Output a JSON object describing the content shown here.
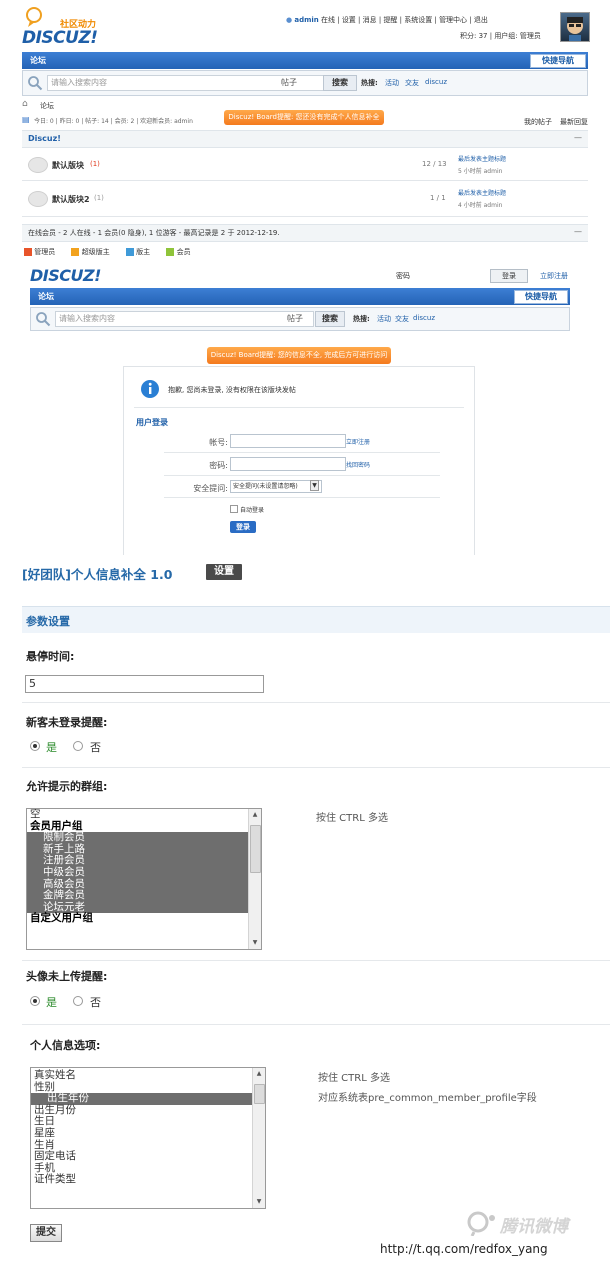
{
  "forum_page": {
    "logo_slogan": "社区动力",
    "logo_text": "DISCUZ!",
    "topbar_user": "admin",
    "topbar_links": [
      "在线",
      "设置",
      "消息",
      "提醒",
      "系统设置",
      "管理中心",
      "退出"
    ],
    "topbar_second": [
      "积分: 37",
      "用户组: 管理员"
    ],
    "nav_tab": "论坛",
    "quick_nav": "快捷导航",
    "search_placeholder": "请输入搜索内容",
    "search_scope": "帖子",
    "search_button": "搜索",
    "hot_label": "热搜:",
    "hot_terms": [
      "活动",
      "交友",
      "discuz"
    ],
    "breadcrumb": "论坛",
    "stats": "今日: 0 | 昨日: 0 | 帖子: 14 | 会员: 2 | 欢迎新会员: admin",
    "orange_notice": "Discuz! Board提醒: 您还没有完成个人信息补全",
    "right_links": [
      "我的帖子",
      "最新回复"
    ],
    "category": "Discuz!",
    "forums": [
      {
        "name": "默认版块",
        "count": "(1)",
        "stats": "12 / 13",
        "last_title": "最后发表主题标题",
        "last_time": "5 小时前 admin"
      },
      {
        "name": "默认版块2",
        "count": "(1)",
        "stats": "1 / 1",
        "last_title": "最后发表主题标题",
        "last_time": "4 小时前 admin"
      }
    ],
    "online_info": "在线会员 - 2 人在线 - 1 会员(0 隐身), 1 位游客 - 最高记录是 2 于 2012-12-19.",
    "legend": [
      "管理员",
      "超级版主",
      "版主",
      "会员"
    ]
  },
  "login_page": {
    "logo_text": "DISCUZ!",
    "top_link": "密码",
    "login_button": "登录",
    "register_link": "立即注册",
    "nav_tab": "论坛",
    "quick_nav": "快捷导航",
    "search_placeholder": "请输入搜索内容",
    "search_scope": "帖子",
    "search_button": "搜索",
    "hot_label": "热搜:",
    "hot_terms": [
      "活动",
      "交友",
      "discuz"
    ],
    "orange_notice": "Discuz! Board提醒: 您的信息不全, 完成后方可进行访问",
    "info_message": "抱歉, 您尚未登录, 没有权限在该版块发帖",
    "section_title": "用户登录",
    "username_label": "帐号:",
    "password_label": "密码:",
    "security_label": "安全提问:",
    "register_text": "立即注册",
    "forgot_text": "找回密码",
    "security_option": "安全提问(未设置请忽略)",
    "remember_label": "自动登录",
    "submit_label": "登录"
  },
  "plugin": {
    "title": "[好团队]个人信息补全 1.0",
    "settings_btn": "设置",
    "section": "参数设置",
    "q_time_label": "悬停时间:",
    "q_time_value": "5",
    "guest_label": "新客未登录提醒:",
    "yes": "是",
    "no": "否",
    "groups_label": "允许提示的群组:",
    "groups_hint": "按住 CTRL 多选",
    "groups": [
      {
        "text": "空",
        "kind": "plain"
      },
      {
        "text": "会员用户组",
        "kind": "group"
      },
      {
        "text": "限制会员",
        "kind": "sel"
      },
      {
        "text": "新手上路",
        "kind": "sel"
      },
      {
        "text": "注册会员",
        "kind": "sel"
      },
      {
        "text": "中级会员",
        "kind": "sel"
      },
      {
        "text": "高级会员",
        "kind": "sel"
      },
      {
        "text": "金牌会员",
        "kind": "sel"
      },
      {
        "text": "论坛元老",
        "kind": "sel"
      },
      {
        "text": "自定义用户组",
        "kind": "group"
      }
    ],
    "avatar_label": "头像未上传提醒:",
    "profile_label": "个人信息选项:",
    "profile_hint_1": "按住 CTRL 多选",
    "profile_hint_2": "对应系统表pre_common_member_profile字段",
    "profile_options": [
      {
        "text": "真实姓名",
        "kind": "plain"
      },
      {
        "text": "性别",
        "kind": "plain"
      },
      {
        "text": "出生年份",
        "kind": "sel"
      },
      {
        "text": "出生月份",
        "kind": "plain"
      },
      {
        "text": "生日",
        "kind": "plain"
      },
      {
        "text": "星座",
        "kind": "plain"
      },
      {
        "text": "生肖",
        "kind": "plain"
      },
      {
        "text": "固定电话",
        "kind": "plain"
      },
      {
        "text": "手机",
        "kind": "plain"
      },
      {
        "text": "证件类型",
        "kind": "plain"
      }
    ],
    "submit": "提交"
  },
  "watermark": {
    "brand": "腾讯微博",
    "url": "http://t.qq.com/redfox_yang"
  }
}
